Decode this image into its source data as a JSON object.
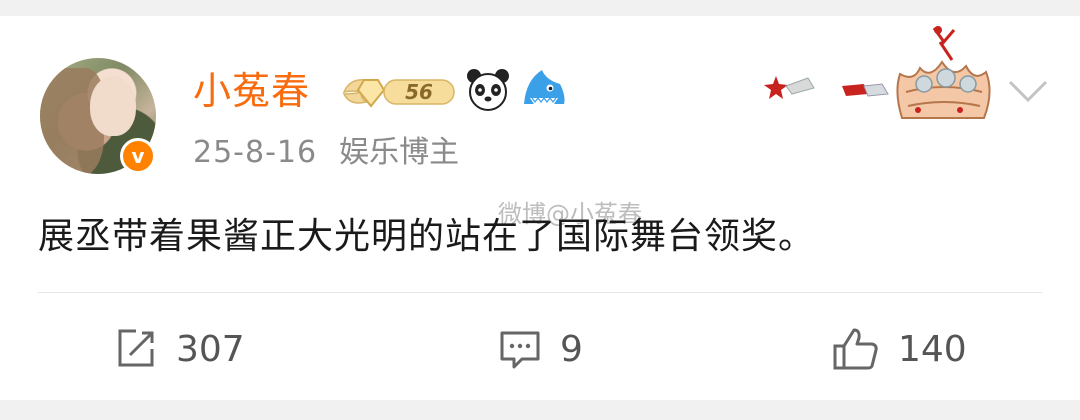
{
  "post": {
    "username": "小菟春",
    "level_badge": "56",
    "date": "25-8-16",
    "role": "娱乐博主",
    "content": "展丞带着果酱正大光明的站在了国际舞台领奖。",
    "watermark": "微博@小菟春"
  },
  "actions": {
    "repost_count": "307",
    "comment_count": "9",
    "like_count": "140"
  },
  "colors": {
    "username": "#f86c0f",
    "verify_badge": "#ff8200",
    "background": "#f1f1f1"
  }
}
